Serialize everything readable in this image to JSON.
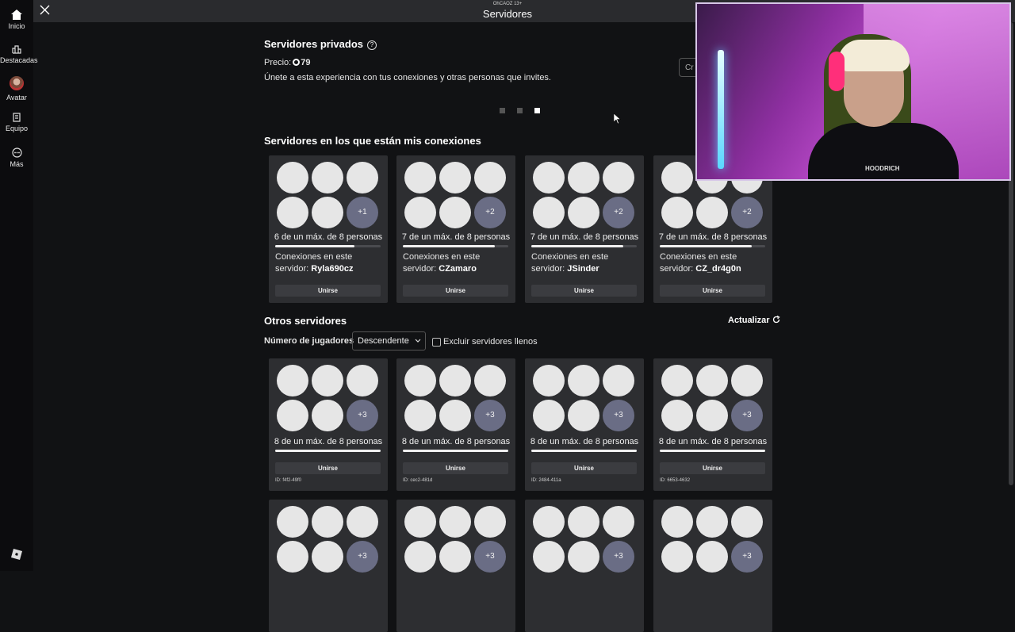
{
  "sidebar": {
    "items": [
      {
        "label": "Inicio"
      },
      {
        "label": "Destacadas"
      },
      {
        "label": "Avatar"
      },
      {
        "label": "Equipo"
      },
      {
        "label": "Más"
      }
    ]
  },
  "header": {
    "subtitle": "OhCAOZ 13+",
    "title": "Servidores"
  },
  "private": {
    "title": "Servidores privados",
    "price_label": "Precio:",
    "price_value": "79",
    "description": "Únete a esta experiencia con tus conexiones y otras personas que invites.",
    "create_button_partial": "Cr"
  },
  "pagination": {
    "total": 3,
    "active_index": 2
  },
  "connections": {
    "title": "Servidores en los que están mis conexiones",
    "conn_label": "Conexiones en este servidor:",
    "cards": [
      {
        "extra": "+1",
        "count": "6 de un máx. de 8 personas",
        "fill": 0.75,
        "name": "Ryla690cz",
        "join": "Unirse"
      },
      {
        "extra": "+2",
        "count": "7 de un máx. de 8 personas",
        "fill": 0.875,
        "name": "CZamaro",
        "join": "Unirse"
      },
      {
        "extra": "+2",
        "count": "7 de un máx. de 8 personas",
        "fill": 0.875,
        "name": "JSinder",
        "join": "Unirse"
      },
      {
        "extra": "+2",
        "count": "7 de un máx. de 8 personas",
        "fill": 0.875,
        "name": "CZ_dr4g0n",
        "join": "Unirse"
      }
    ]
  },
  "others": {
    "title": "Otros servidores",
    "refresh_label": "Actualizar",
    "sort_label": "Número de jugadores",
    "sort_value": "Descendente",
    "exclude_label": "Excluir servidores llenos",
    "cards": [
      {
        "extra": "+3",
        "count": "8 de un máx. de 8 personas",
        "fill": 1,
        "join": "Unirse",
        "id": "ID: f4f2-49f0"
      },
      {
        "extra": "+3",
        "count": "8 de un máx. de 8 personas",
        "fill": 1,
        "join": "Unirse",
        "id": "ID: cec2-481d"
      },
      {
        "extra": "+3",
        "count": "8 de un máx. de 8 personas",
        "fill": 1,
        "join": "Unirse",
        "id": "ID: 2484-411a"
      },
      {
        "extra": "+3",
        "count": "8 de un máx. de 8 personas",
        "fill": 1,
        "join": "Unirse",
        "id": "ID: 6653-4632"
      },
      {
        "extra": "+3"
      },
      {
        "extra": "+3"
      },
      {
        "extra": "+3"
      },
      {
        "extra": "+3"
      }
    ]
  },
  "webcam": {
    "shirt_text": "HOODRICH"
  },
  "icons": {
    "home": "home-icon",
    "featured": "chart-icon",
    "equip": "shirt-icon",
    "more": "more-icon",
    "close": "close-icon",
    "refresh": "refresh-icon"
  }
}
